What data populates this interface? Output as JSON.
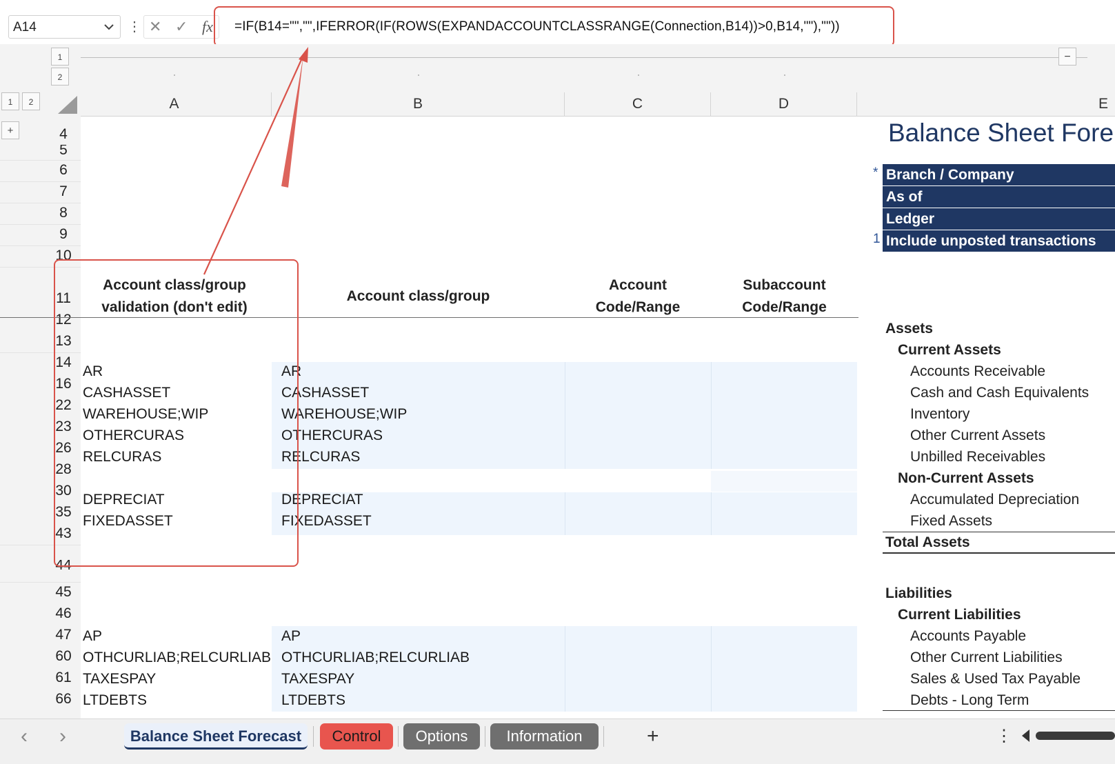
{
  "formula_bar": {
    "name_box": "A14",
    "cancel_glyph": "✕",
    "enter_glyph": "✓",
    "fx_label": "fx",
    "formula": "=IF(B14=\"\",\"\",IFERROR(IF(ROWS(EXPANDACCOUNTCLASSRANGE(Connection,B14))>0,B14,\"\"),\"\"))"
  },
  "outline": {
    "column_levels": [
      "1",
      "2"
    ],
    "row_levels": [
      "1",
      "2"
    ],
    "expand_symbol": "+",
    "collapse_symbol": "−"
  },
  "columns": [
    "A",
    "B",
    "C",
    "D",
    "E"
  ],
  "rows": [
    "4",
    "5",
    "6",
    "7",
    "8",
    "9",
    "10",
    "11",
    "12",
    "13",
    "14",
    "16",
    "22",
    "23",
    "26",
    "28",
    "30",
    "35",
    "43",
    "44",
    "45",
    "46",
    "47",
    "60",
    "61",
    "66"
  ],
  "headers": {
    "col_a": "Account class/group validation (don't edit)",
    "col_b": "Account class/group",
    "col_c": "Account Code/Range",
    "col_d": "Subaccount Code/Range"
  },
  "data_rows": [
    {
      "a": "AR",
      "b": "AR"
    },
    {
      "a": "CASHASSET",
      "b": "CASHASSET"
    },
    {
      "a": "WAREHOUSE;WIP",
      "b": "WAREHOUSE;WIP"
    },
    {
      "a": "OTHERCURAS",
      "b": "OTHERCURAS"
    },
    {
      "a": "RELCURAS",
      "b": "RELCURAS"
    },
    {
      "a": "DEPRECIAT",
      "b": "DEPRECIAT"
    },
    {
      "a": "FIXEDASSET",
      "b": "FIXEDASSET"
    },
    {
      "a": "AP",
      "b": "AP"
    },
    {
      "a": "OTHCURLIAB;RELCURLIAB",
      "b": "OTHCURLIAB;RELCURLIAB"
    },
    {
      "a": "TAXESPAY",
      "b": "TAXESPAY"
    },
    {
      "a": "LTDEBTS",
      "b": "LTDEBTS"
    }
  ],
  "report": {
    "title": "Balance Sheet Fore",
    "param_required_mark": "*",
    "param_flag_value": "1",
    "params": [
      "Branch / Company",
      "As of",
      "Ledger",
      "Include unposted transactions"
    ],
    "assets": "Assets",
    "current_assets": "Current Assets",
    "current_asset_items": [
      "Accounts Receivable",
      "Cash and Cash Equivalents",
      "Inventory",
      "Other Current Assets",
      "Unbilled Receivables"
    ],
    "non_current_assets": "Non-Current Assets",
    "non_current_asset_items": [
      "Accumulated Depreciation",
      "Fixed Assets"
    ],
    "total_assets": "Total Assets",
    "liabilities": "Liabilities",
    "current_liabilities": "Current Liabilities",
    "current_liability_items": [
      "Accounts Payable",
      "Other Current Liabilities",
      "Sales & Used Tax Payable",
      "Debts - Long Term"
    ]
  },
  "sheet_tabs": [
    {
      "label": "Balance Sheet Forecast",
      "active": true
    },
    {
      "label": "Control",
      "color": "#e8554e"
    },
    {
      "label": "Options",
      "color": "#6f6f6f"
    },
    {
      "label": "Information",
      "color": "#6f6f6f"
    }
  ],
  "tab_nav": {
    "prev": "‹",
    "next": "›",
    "add": "+",
    "more": "⋮"
  },
  "colors": {
    "annotation_red": "#d9534a",
    "header_navy": "#1f3763",
    "title_blue": "#1f3763",
    "input_band": "#eef5fd"
  }
}
